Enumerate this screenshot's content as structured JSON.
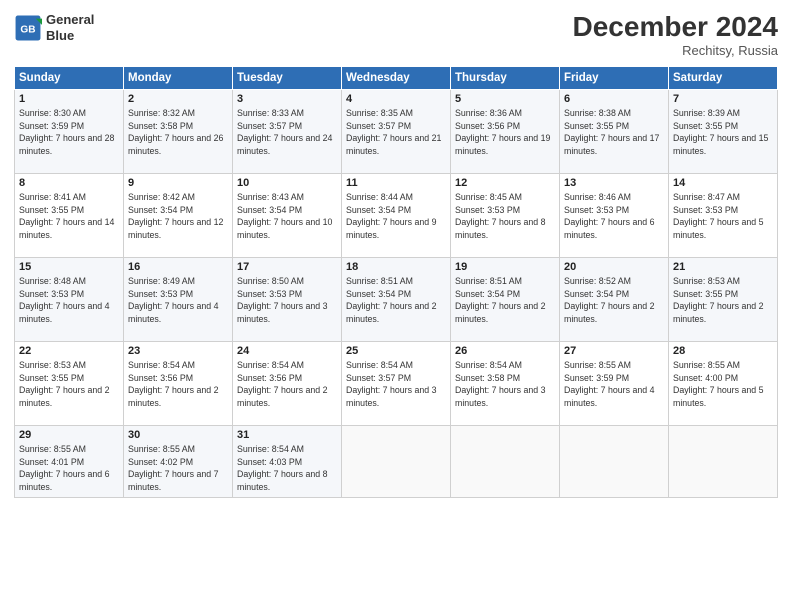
{
  "header": {
    "logo_line1": "General",
    "logo_line2": "Blue",
    "month": "December 2024",
    "location": "Rechitsy, Russia"
  },
  "weekdays": [
    "Sunday",
    "Monday",
    "Tuesday",
    "Wednesday",
    "Thursday",
    "Friday",
    "Saturday"
  ],
  "weeks": [
    [
      {
        "day": "1",
        "rise": "Sunrise: 8:30 AM",
        "set": "Sunset: 3:59 PM",
        "daylight": "Daylight: 7 hours and 28 minutes."
      },
      {
        "day": "2",
        "rise": "Sunrise: 8:32 AM",
        "set": "Sunset: 3:58 PM",
        "daylight": "Daylight: 7 hours and 26 minutes."
      },
      {
        "day": "3",
        "rise": "Sunrise: 8:33 AM",
        "set": "Sunset: 3:57 PM",
        "daylight": "Daylight: 7 hours and 24 minutes."
      },
      {
        "day": "4",
        "rise": "Sunrise: 8:35 AM",
        "set": "Sunset: 3:57 PM",
        "daylight": "Daylight: 7 hours and 21 minutes."
      },
      {
        "day": "5",
        "rise": "Sunrise: 8:36 AM",
        "set": "Sunset: 3:56 PM",
        "daylight": "Daylight: 7 hours and 19 minutes."
      },
      {
        "day": "6",
        "rise": "Sunrise: 8:38 AM",
        "set": "Sunset: 3:55 PM",
        "daylight": "Daylight: 7 hours and 17 minutes."
      },
      {
        "day": "7",
        "rise": "Sunrise: 8:39 AM",
        "set": "Sunset: 3:55 PM",
        "daylight": "Daylight: 7 hours and 15 minutes."
      }
    ],
    [
      {
        "day": "8",
        "rise": "Sunrise: 8:41 AM",
        "set": "Sunset: 3:55 PM",
        "daylight": "Daylight: 7 hours and 14 minutes."
      },
      {
        "day": "9",
        "rise": "Sunrise: 8:42 AM",
        "set": "Sunset: 3:54 PM",
        "daylight": "Daylight: 7 hours and 12 minutes."
      },
      {
        "day": "10",
        "rise": "Sunrise: 8:43 AM",
        "set": "Sunset: 3:54 PM",
        "daylight": "Daylight: 7 hours and 10 minutes."
      },
      {
        "day": "11",
        "rise": "Sunrise: 8:44 AM",
        "set": "Sunset: 3:54 PM",
        "daylight": "Daylight: 7 hours and 9 minutes."
      },
      {
        "day": "12",
        "rise": "Sunrise: 8:45 AM",
        "set": "Sunset: 3:53 PM",
        "daylight": "Daylight: 7 hours and 8 minutes."
      },
      {
        "day": "13",
        "rise": "Sunrise: 8:46 AM",
        "set": "Sunset: 3:53 PM",
        "daylight": "Daylight: 7 hours and 6 minutes."
      },
      {
        "day": "14",
        "rise": "Sunrise: 8:47 AM",
        "set": "Sunset: 3:53 PM",
        "daylight": "Daylight: 7 hours and 5 minutes."
      }
    ],
    [
      {
        "day": "15",
        "rise": "Sunrise: 8:48 AM",
        "set": "Sunset: 3:53 PM",
        "daylight": "Daylight: 7 hours and 4 minutes."
      },
      {
        "day": "16",
        "rise": "Sunrise: 8:49 AM",
        "set": "Sunset: 3:53 PM",
        "daylight": "Daylight: 7 hours and 4 minutes."
      },
      {
        "day": "17",
        "rise": "Sunrise: 8:50 AM",
        "set": "Sunset: 3:53 PM",
        "daylight": "Daylight: 7 hours and 3 minutes."
      },
      {
        "day": "18",
        "rise": "Sunrise: 8:51 AM",
        "set": "Sunset: 3:54 PM",
        "daylight": "Daylight: 7 hours and 2 minutes."
      },
      {
        "day": "19",
        "rise": "Sunrise: 8:51 AM",
        "set": "Sunset: 3:54 PM",
        "daylight": "Daylight: 7 hours and 2 minutes."
      },
      {
        "day": "20",
        "rise": "Sunrise: 8:52 AM",
        "set": "Sunset: 3:54 PM",
        "daylight": "Daylight: 7 hours and 2 minutes."
      },
      {
        "day": "21",
        "rise": "Sunrise: 8:53 AM",
        "set": "Sunset: 3:55 PM",
        "daylight": "Daylight: 7 hours and 2 minutes."
      }
    ],
    [
      {
        "day": "22",
        "rise": "Sunrise: 8:53 AM",
        "set": "Sunset: 3:55 PM",
        "daylight": "Daylight: 7 hours and 2 minutes."
      },
      {
        "day": "23",
        "rise": "Sunrise: 8:54 AM",
        "set": "Sunset: 3:56 PM",
        "daylight": "Daylight: 7 hours and 2 minutes."
      },
      {
        "day": "24",
        "rise": "Sunrise: 8:54 AM",
        "set": "Sunset: 3:56 PM",
        "daylight": "Daylight: 7 hours and 2 minutes."
      },
      {
        "day": "25",
        "rise": "Sunrise: 8:54 AM",
        "set": "Sunset: 3:57 PM",
        "daylight": "Daylight: 7 hours and 3 minutes."
      },
      {
        "day": "26",
        "rise": "Sunrise: 8:54 AM",
        "set": "Sunset: 3:58 PM",
        "daylight": "Daylight: 7 hours and 3 minutes."
      },
      {
        "day": "27",
        "rise": "Sunrise: 8:55 AM",
        "set": "Sunset: 3:59 PM",
        "daylight": "Daylight: 7 hours and 4 minutes."
      },
      {
        "day": "28",
        "rise": "Sunrise: 8:55 AM",
        "set": "Sunset: 4:00 PM",
        "daylight": "Daylight: 7 hours and 5 minutes."
      }
    ],
    [
      {
        "day": "29",
        "rise": "Sunrise: 8:55 AM",
        "set": "Sunset: 4:01 PM",
        "daylight": "Daylight: 7 hours and 6 minutes."
      },
      {
        "day": "30",
        "rise": "Sunrise: 8:55 AM",
        "set": "Sunset: 4:02 PM",
        "daylight": "Daylight: 7 hours and 7 minutes."
      },
      {
        "day": "31",
        "rise": "Sunrise: 8:54 AM",
        "set": "Sunset: 4:03 PM",
        "daylight": "Daylight: 7 hours and 8 minutes."
      },
      null,
      null,
      null,
      null
    ]
  ]
}
